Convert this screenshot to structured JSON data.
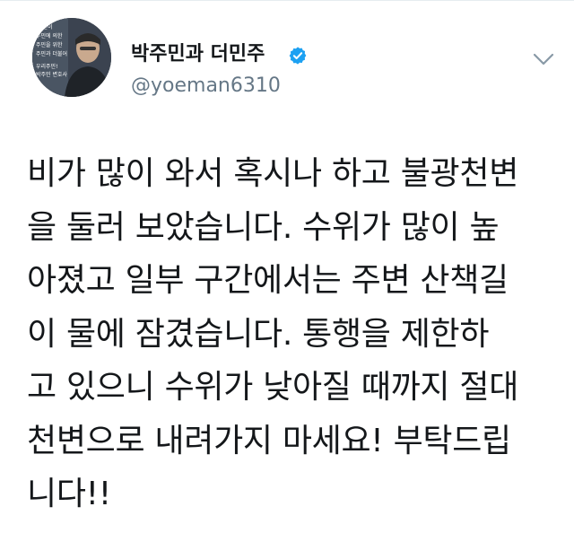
{
  "tweet": {
    "author": {
      "display_name": "박주민과 더민주",
      "handle": "@yoeman6310",
      "verified": true
    },
    "avatar_text": [
      "주민이",
      "주민에 의한",
      "주민을 위한",
      "주민과 더불어",
      "우리주민!",
      "박주민 변호사"
    ],
    "text_lines": [
      "비가 많이 와서 혹시나 하고 불광천변",
      "을 둘러 보았습니다. 수위가 많이 높",
      "아졌고 일부 구간에서는 주변 산책길",
      "이 물에 잠겼습니다. 통행을 제한하",
      "고 있으니 수위가 낮아질 때까지 절대",
      "천변으로 내려가지 마세요! 부탁드립",
      "니다!!"
    ]
  },
  "icons": {
    "verified": "verified-badge-icon",
    "menu": "chevron-down-icon"
  },
  "colors": {
    "verified_blue": "#1da1f2",
    "handle_gray": "#657786",
    "text": "#14171a"
  }
}
